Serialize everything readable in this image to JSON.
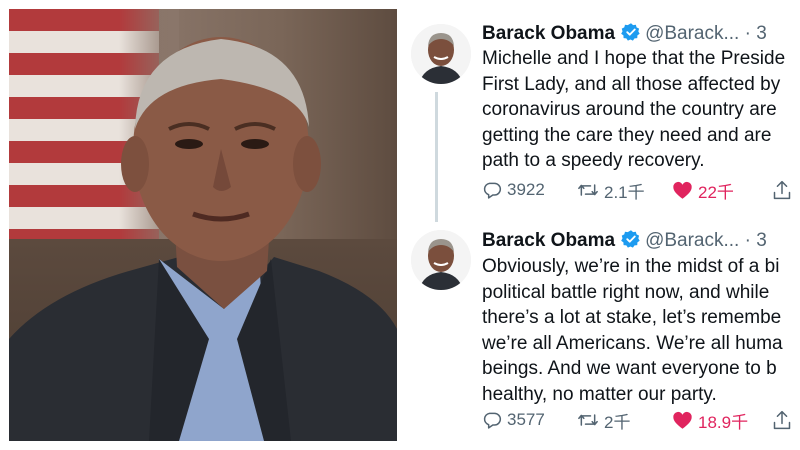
{
  "tweets": [
    {
      "author_name": "Barack Obama",
      "handle": "@Barack...",
      "separator": "·",
      "time": "3",
      "text_lines": [
        "Michelle and I hope that the Preside",
        "First Lady, and all those affected by",
        "coronavirus around the country are",
        "getting the care they need and are",
        "path to a speedy recovery."
      ],
      "replies": "3922",
      "retweets": "2.1千",
      "likes": "22千"
    },
    {
      "author_name": "Barack Obama",
      "handle": "@Barack...",
      "separator": "·",
      "time": "3",
      "text_lines": [
        "Obviously, we’re in the midst of a bi",
        "political battle right now, and while",
        "there’s a lot at stake, let’s remembe",
        "we’re all Americans. We’re all huma",
        "beings. And we want everyone to b",
        "healthy, no matter our party."
      ],
      "replies": "3577",
      "retweets": "2千",
      "likes": "18.9千"
    }
  ],
  "icons": {
    "verified": "verified-badge-icon",
    "reply": "reply-icon",
    "retweet": "retweet-icon",
    "like": "heart-icon",
    "share": "share-icon"
  },
  "colors": {
    "text": "#0f1419",
    "secondary": "#536471",
    "verified": "#1d9bf0",
    "like": "#e0245e",
    "thread_line": "#cfd9de"
  }
}
